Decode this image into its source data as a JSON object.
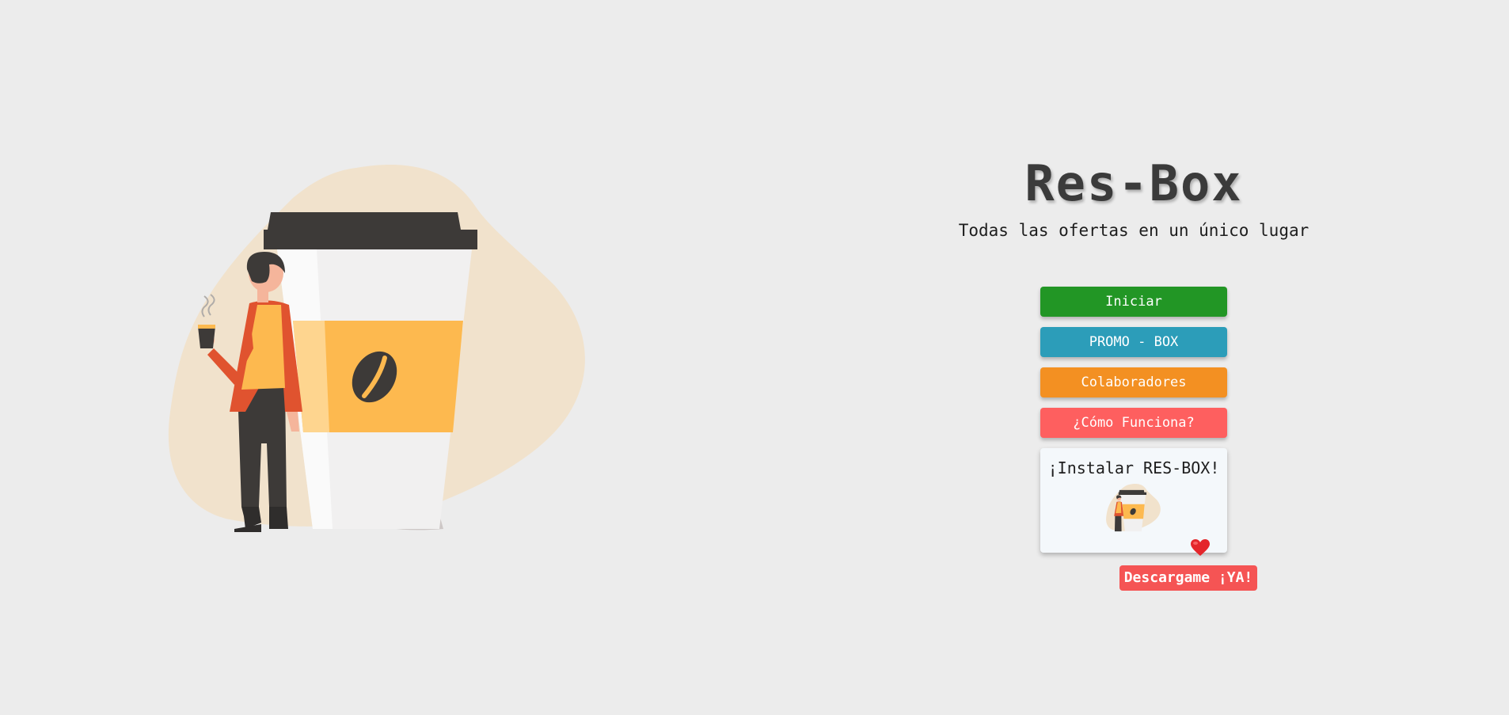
{
  "header": {
    "title": "Res-Box",
    "tagline": "Todas las ofertas en un único lugar"
  },
  "menu": {
    "buttons": [
      {
        "label": "Iniciar",
        "color": "#229625"
      },
      {
        "label": "PROMO - BOX",
        "color": "#2c9db9"
      },
      {
        "label": "Colaboradores",
        "color": "#f39022"
      },
      {
        "label": "¿Cómo Funciona?",
        "color": "#fe5f5f"
      }
    ],
    "install_label": "¡Instalar RES-BOX!"
  },
  "download": {
    "label": "Descargame ¡YA!",
    "color": "#f55454"
  },
  "icons": {
    "heart": "heart-icon",
    "coffee_bean": "coffee-bean-icon"
  },
  "colors": {
    "background": "#ececec",
    "blob": "#f1e2cc",
    "cup_lid": "#3d3a38",
    "cup_sleeve": "#fdb94f"
  }
}
